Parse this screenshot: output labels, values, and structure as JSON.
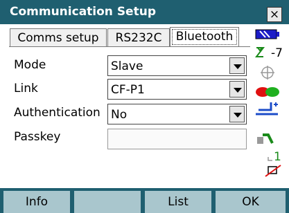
{
  "window": {
    "title": "Communication Setup",
    "close_label": "×"
  },
  "tabs": [
    {
      "label": "Comms setup"
    },
    {
      "label": "RS232C"
    },
    {
      "label": "Bluetooth"
    }
  ],
  "form": {
    "mode_label": "Mode",
    "mode_value": "Slave",
    "link_label": "Link",
    "link_value": "CF-P1",
    "auth_label": "Authentication",
    "auth_value": "No",
    "passkey_label": "Passkey",
    "passkey_value": ""
  },
  "status": {
    "tilt_value": "-7",
    "counter_value": "1",
    "icons": [
      "battery-icon",
      "tilt-icon",
      "target-icon",
      "signal-icon",
      "prism-icon",
      "instrument-icon",
      "counter-icon",
      "memory-icon"
    ]
  },
  "softkeys": [
    {
      "label": "Info"
    },
    {
      "label": ""
    },
    {
      "label": "List"
    },
    {
      "label": "OK"
    }
  ],
  "colors": {
    "titlebar": "#1f5f70",
    "softkey": "#a9c6cd"
  }
}
